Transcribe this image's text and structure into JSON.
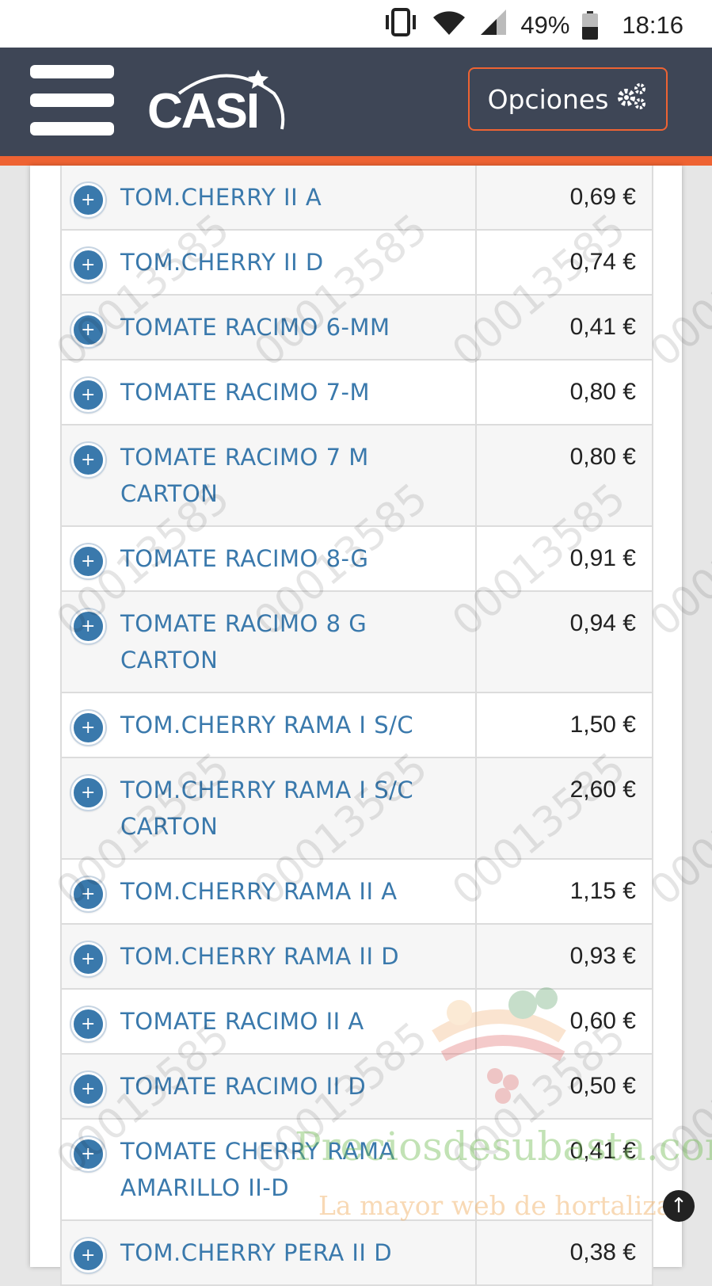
{
  "status_bar": {
    "battery": "49%",
    "time": "18:16"
  },
  "header": {
    "logo_text": "CASI",
    "options_label": "Opciones"
  },
  "rows": [
    {
      "name": "TOM.CHERRY II A",
      "price": "0,69 €"
    },
    {
      "name": "TOM.CHERRY II D",
      "price": "0,74 €"
    },
    {
      "name": "TOMATE RACIMO 6-MM",
      "price": "0,41 €"
    },
    {
      "name": "TOMATE RACIMO 7-M",
      "price": "0,80 €"
    },
    {
      "name": "TOMATE RACIMO 7 M CARTON",
      "price": "0,80 €"
    },
    {
      "name": "TOMATE RACIMO 8-G",
      "price": "0,91 €"
    },
    {
      "name": "TOMATE RACIMO 8 G CARTON",
      "price": "0,94 €"
    },
    {
      "name": "TOM.CHERRY RAMA I S/C",
      "price": "1,50 €"
    },
    {
      "name": "TOM.CHERRY RAMA I S/C CARTON",
      "price": "2,60 €"
    },
    {
      "name": "TOM.CHERRY RAMA II A",
      "price": "1,15 €"
    },
    {
      "name": "TOM.CHERRY RAMA II D",
      "price": "0,93 €"
    },
    {
      "name": "TOMATE RACIMO II A",
      "price": "0,60 €"
    },
    {
      "name": "TOMATE RACIMO II D",
      "price": "0,50 €"
    },
    {
      "name": "TOMATE CHERRY RAMA AMARILLO II-D",
      "price": "0,41 €"
    },
    {
      "name": "TOM.CHERRY PERA II D",
      "price": "0,38 €"
    }
  ],
  "watermark": {
    "number": "00013585",
    "site_title": "Preciosdesubasta.com",
    "site_subtitle": "La mayor web de hortalizas"
  }
}
